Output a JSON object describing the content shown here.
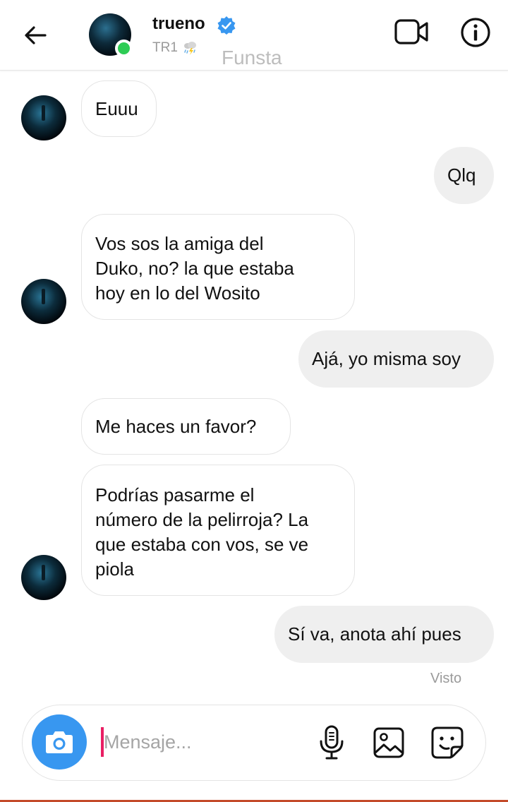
{
  "header": {
    "name": "trueno",
    "subtitle": "TR1",
    "watermark": "Funsta"
  },
  "icons": {
    "back": "arrow-left-icon",
    "verified": "verified-badge-icon",
    "storm": "storm-cloud-emoji",
    "video": "video-camera-icon",
    "info": "info-icon",
    "camera": "camera-icon",
    "mic": "microphone-icon",
    "gallery": "image-gallery-icon",
    "sticker": "sticker-icon"
  },
  "colors": {
    "verified": "#3897f0",
    "online": "#2ecc55",
    "camera_button": "#3897f0",
    "caret": "#e91e63"
  },
  "messages": [
    {
      "side": "incoming",
      "lines": [
        "Euuu"
      ]
    },
    {
      "side": "outgoing",
      "lines": [
        "Qlq"
      ]
    },
    {
      "side": "incoming",
      "lines": [
        "Vos sos la amiga del",
        "Duko, no? la que estaba",
        "hoy en lo del Wosito"
      ]
    },
    {
      "side": "outgoing",
      "lines": [
        "Ajá, yo misma soy"
      ]
    },
    {
      "side": "incoming",
      "lines": [
        "Me haces un favor?"
      ]
    },
    {
      "side": "incoming",
      "lines": [
        "Podrías pasarme el",
        "número de la pelirroja? La",
        "que estaba con vos, se ve",
        "piola"
      ]
    },
    {
      "side": "outgoing",
      "lines": [
        "Sí va, anota ahí pues"
      ]
    }
  ],
  "seen_label": "Visto",
  "composer": {
    "placeholder": "Mensaje..."
  }
}
